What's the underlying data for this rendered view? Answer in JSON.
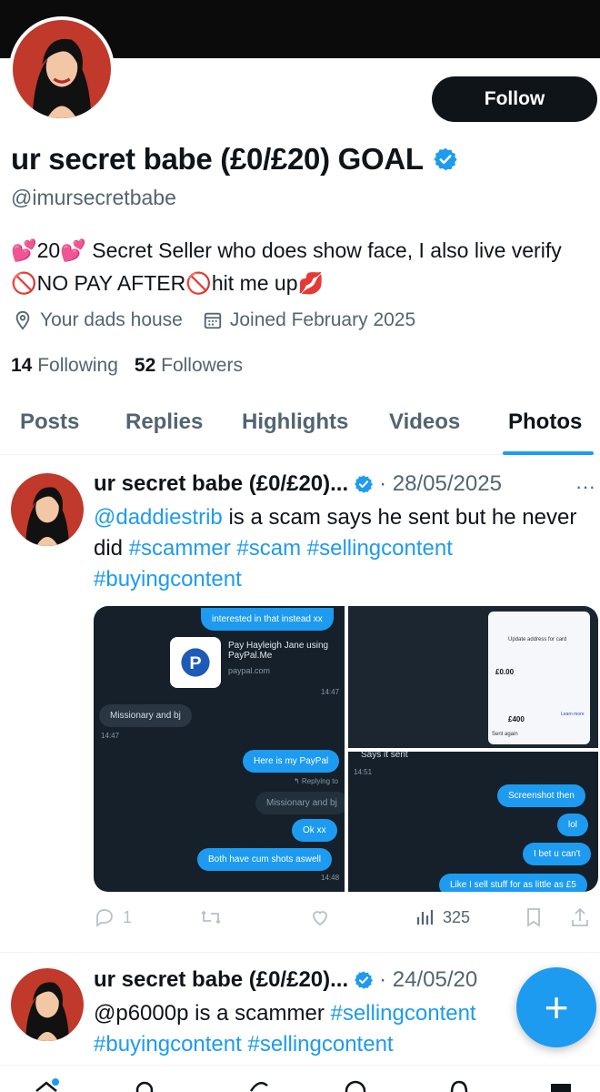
{
  "profile": {
    "display_name": "ur secret babe (£0/£20) GOAL",
    "handle": "@imursecretbabe",
    "follow_label": "Follow",
    "bio": {
      "heart1": "💕",
      "num": "20",
      "heart2": "💕",
      "line": " Secret Seller who does show face, I also live verify ",
      "no1": "🚫",
      "caps": "NO PAY AFTER",
      "no2": "🚫",
      "end": "hit me up",
      "kiss": "💋"
    },
    "location": "Your dads house",
    "joined": "Joined February 2025",
    "following_count": "14",
    "following_label": "Following",
    "followers_count": "52",
    "followers_label": "Followers"
  },
  "tabs": [
    "Posts",
    "Replies",
    "Highlights",
    "Videos",
    "Photos"
  ],
  "active_tab": "Photos",
  "tweets": [
    {
      "name": "ur secret babe (£0/£20)...",
      "date": "· 28/05/2025",
      "more": "···",
      "text_mention": "@daddiestrib",
      "text_body": " is a scam says he sent but he never did ",
      "tags": "#scammer #scam #sellingcontent #buyingcontent",
      "replies": "1",
      "views": "325"
    },
    {
      "name": "ur secret babe (£0/£20)...",
      "date": "· 24/05/20",
      "text_mention": "@p6000p",
      "text_body": " is a scammer ",
      "tags": "#sellingcontent #buyingcontent #sellingcontent"
    }
  ],
  "screenshot_left": {
    "top_bubble": "interested in that instead xx",
    "paypal_title": "Pay Hayleigh Jane using PayPal.Me",
    "paypal_domain": "paypal.com",
    "time1": "14:47",
    "missionary": "Missionary and bj",
    "time2": "14:47",
    "here_paypal": "Here is my PayPal",
    "replying": "↰ Replying to",
    "reply_quote": "Missionary and bj",
    "okxx": "Ok xx",
    "both": "Both have cum shots aswell",
    "time3": "14:48"
  },
  "screenshot_topright": {
    "update_address": "Update address for card",
    "paypal_balance": "£0.00",
    "amount": "£400",
    "sent_again": "Sent again",
    "learn_more": "Learn more"
  },
  "screenshot_bottomright": {
    "says_sent": "Says it sent",
    "time": "14:51",
    "b1": "Screenshot then",
    "b2": "lol",
    "b3": "I bet u can't",
    "b4": "Like I sell stuff for as little as £5"
  },
  "colors": {
    "accent": "#1d9bf0",
    "text": "#0f1419",
    "muted": "#536471"
  },
  "fab_label": "+"
}
